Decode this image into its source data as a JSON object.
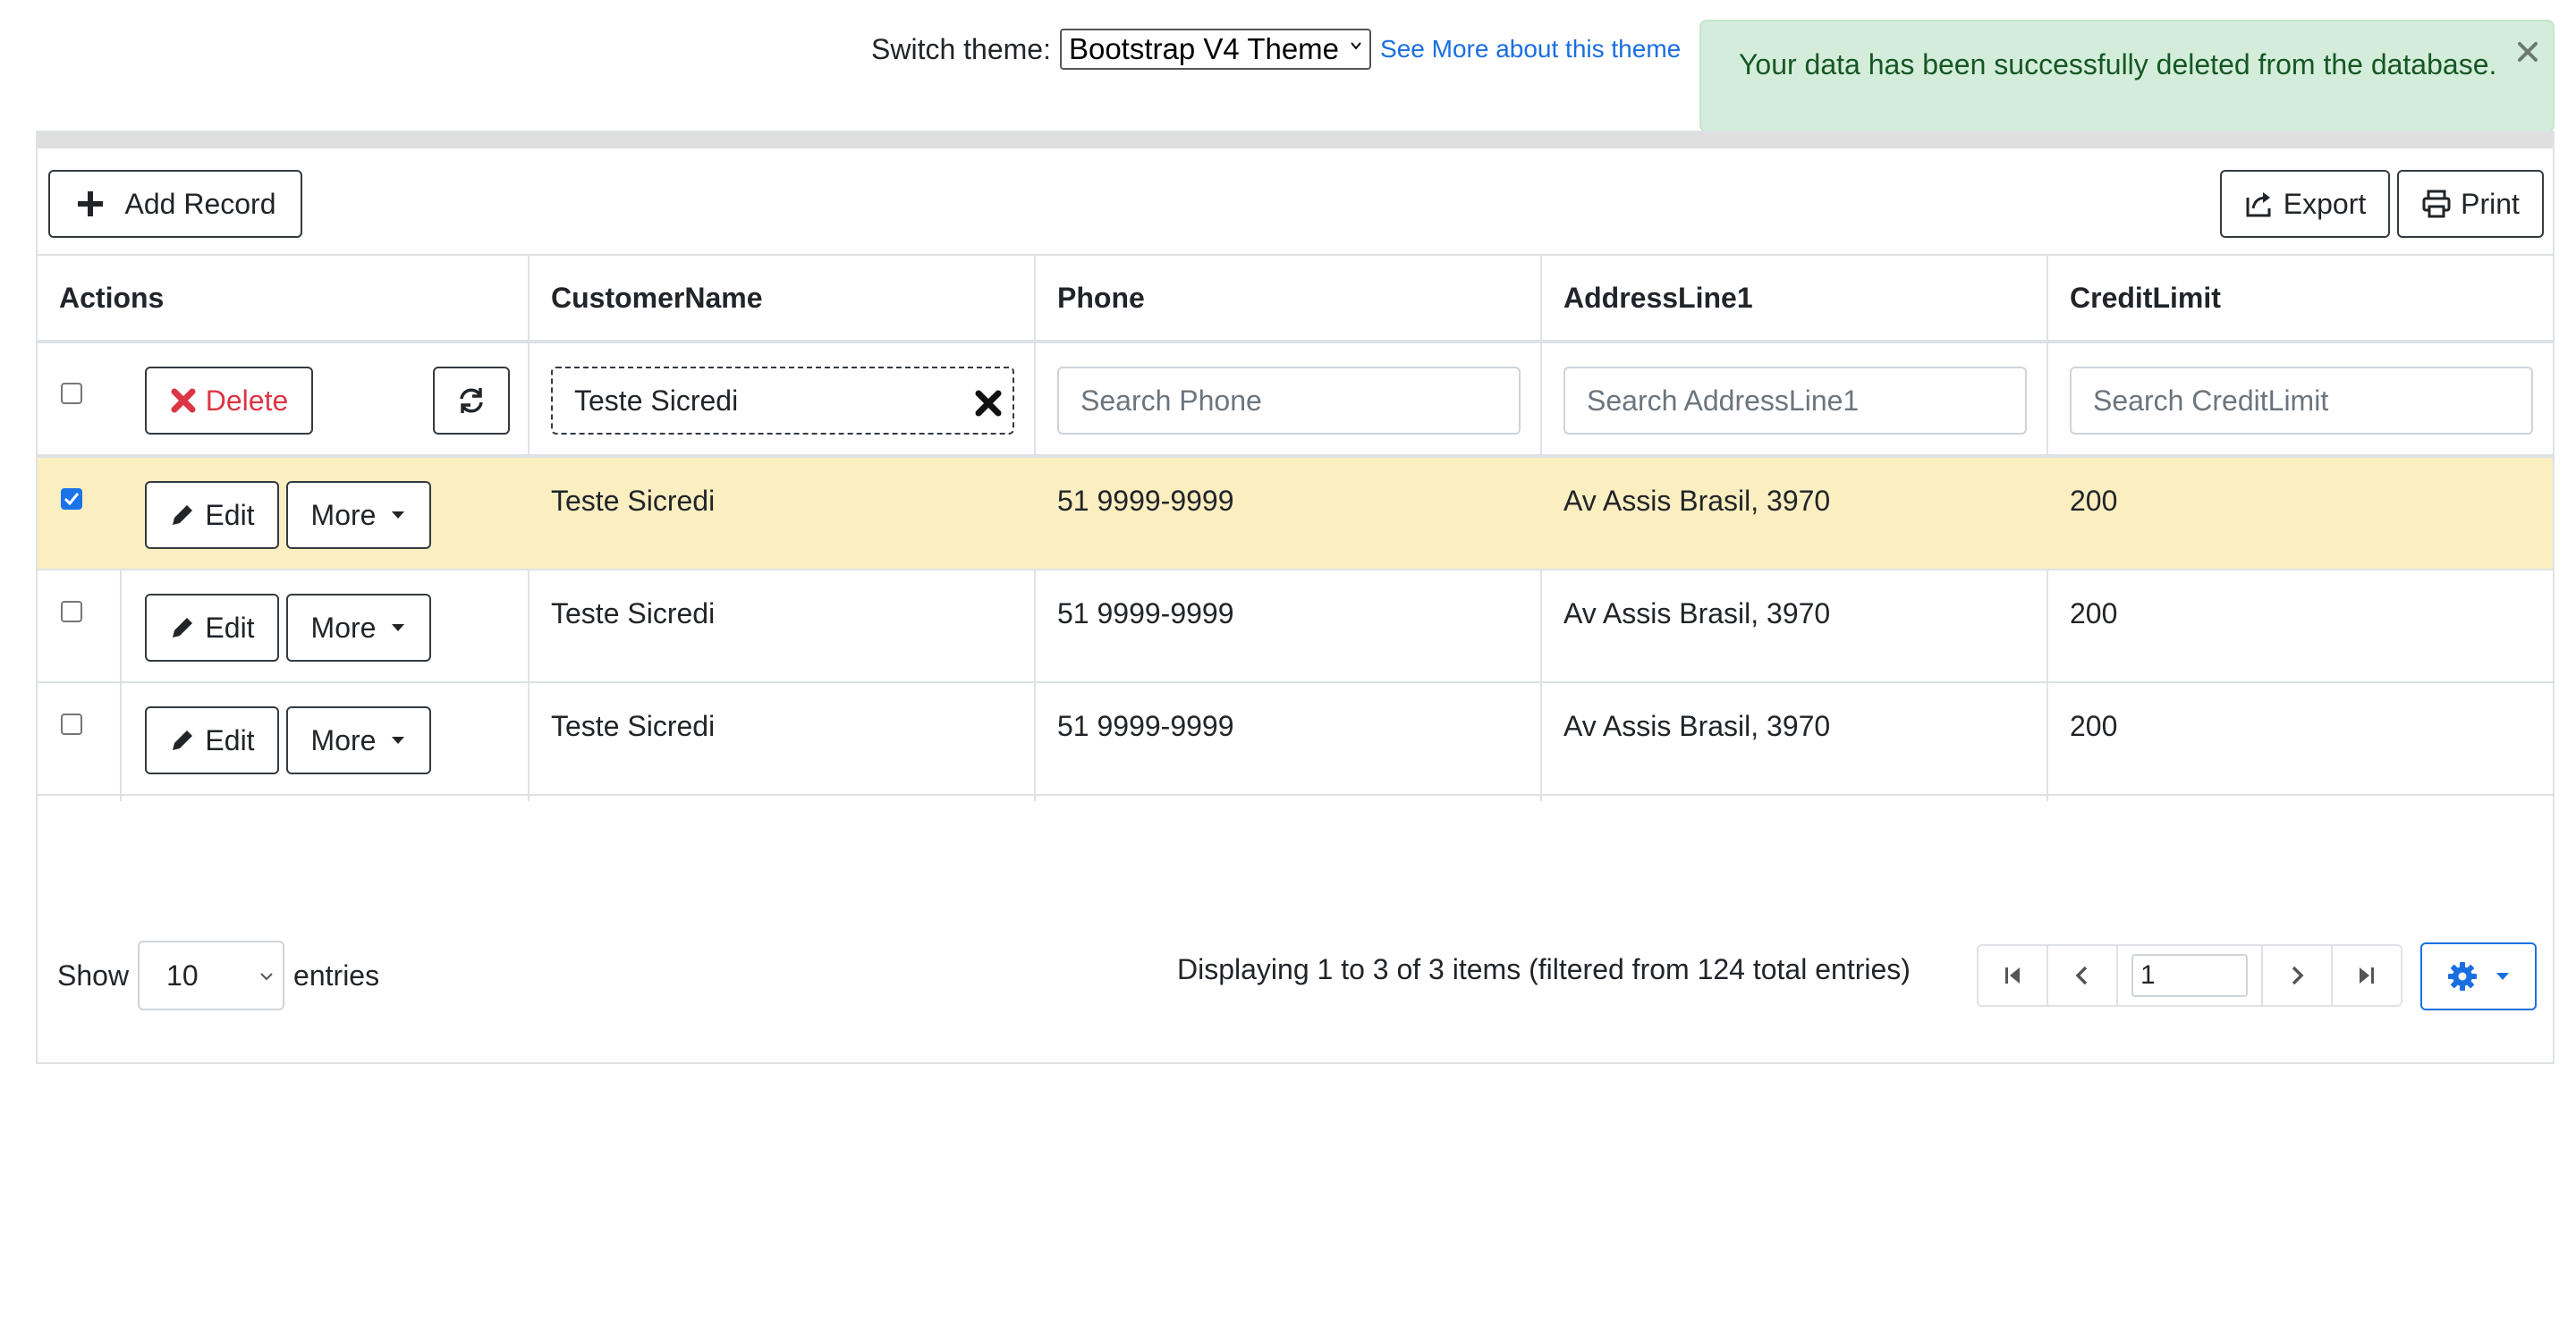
{
  "theme_switcher": {
    "label": "Switch theme:",
    "selected": "Bootstrap V4 Theme",
    "link": "See More about this theme"
  },
  "alert": {
    "message": "Your data has been successfully deleted from the database.",
    "close_icon": "close-icon",
    "color": "#155724",
    "background": "#d4edda"
  },
  "toolbar": {
    "add_label": "Add Record",
    "export_label": "Export",
    "print_label": "Print"
  },
  "columns": [
    "Actions",
    "CustomerName",
    "Phone",
    "AddressLine1",
    "CreditLimit"
  ],
  "filters": {
    "delete_label": "Delete",
    "customer_name_value": "Teste Sicredi",
    "phone_placeholder": "Search Phone",
    "address_placeholder": "Search AddressLine1",
    "credit_placeholder": "Search CreditLimit"
  },
  "row_actions": {
    "edit_label": "Edit",
    "more_label": "More"
  },
  "rows": [
    {
      "selected": true,
      "customer": "Teste Sicredi",
      "phone": "51 9999-9999",
      "address": "Av Assis Brasil, 3970",
      "credit": "200"
    },
    {
      "selected": false,
      "customer": "Teste Sicredi",
      "phone": "51 9999-9999",
      "address": "Av Assis Brasil, 3970",
      "credit": "200"
    },
    {
      "selected": false,
      "customer": "Teste Sicredi",
      "phone": "51 9999-9999",
      "address": "Av Assis Brasil, 3970",
      "credit": "200"
    }
  ],
  "footer": {
    "show_label": "Show",
    "per_page": "10",
    "entries_label": "entries",
    "info": "Displaying 1 to 3 of 3 items (filtered from 124 total entries)",
    "page": "1"
  },
  "colors": {
    "selected_row": "#fbeec1",
    "danger": "#dc3545",
    "link": "#1a6fe0"
  }
}
